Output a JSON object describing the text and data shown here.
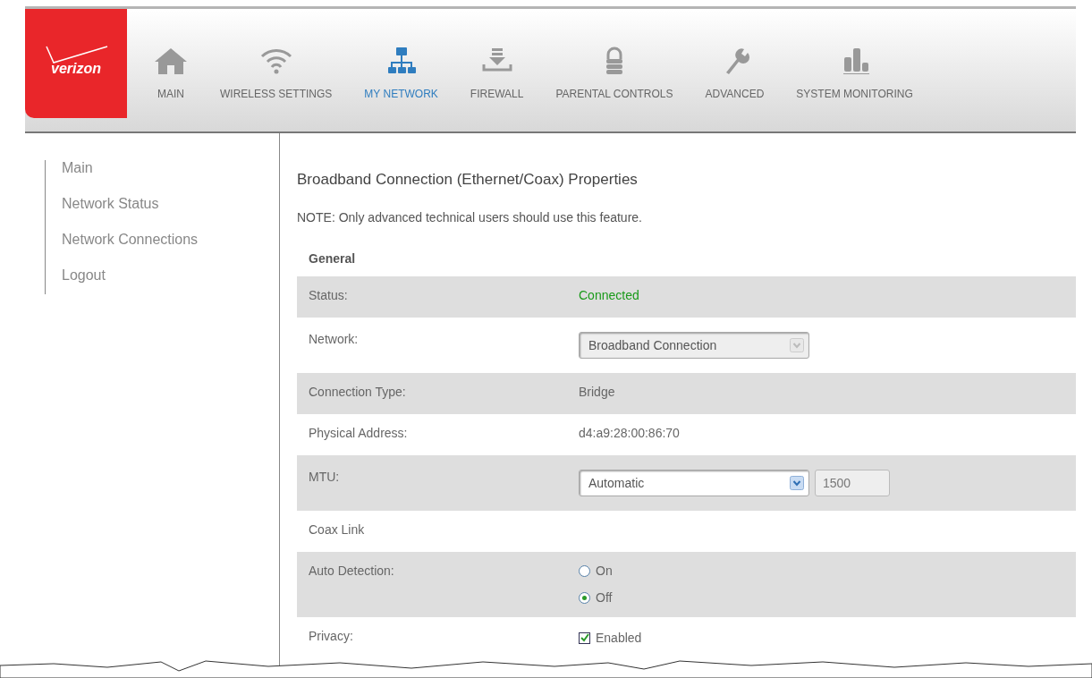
{
  "logo": {
    "text": "verizon"
  },
  "nav": [
    {
      "label": "MAIN",
      "kind": "home",
      "selected": false
    },
    {
      "label": "WIRELESS SETTINGS",
      "kind": "wifi",
      "selected": false
    },
    {
      "label": "MY NETWORK",
      "kind": "network",
      "selected": true
    },
    {
      "label": "FIREWALL",
      "kind": "firewall",
      "selected": false
    },
    {
      "label": "PARENTAL CONTROLS",
      "kind": "lock",
      "selected": false
    },
    {
      "label": "ADVANCED",
      "kind": "wrench",
      "selected": false
    },
    {
      "label": "SYSTEM MONITORING",
      "kind": "chart",
      "selected": false
    }
  ],
  "sidebar": {
    "items": [
      {
        "label": "Main"
      },
      {
        "label": "Network Status"
      },
      {
        "label": "Network Connections"
      },
      {
        "label": "Logout"
      }
    ]
  },
  "title": "Broadband Connection (Ethernet/Coax) Properties",
  "note": "NOTE: Only advanced technical users should use this feature.",
  "section": "General",
  "rows": [
    {
      "kind": "status",
      "label": "Status:",
      "value": "Connected"
    },
    {
      "kind": "select",
      "label": "Network:",
      "value": "Broadband Connection",
      "disabled": true
    },
    {
      "kind": "text",
      "label": "Connection Type:",
      "value": "Bridge"
    },
    {
      "kind": "text",
      "label": "Physical Address:",
      "value": "d4:a9:28:00:86:70"
    },
    {
      "kind": "mtu",
      "label": "MTU:",
      "value": "Automatic",
      "input": "1500",
      "disabled": false
    },
    {
      "kind": "heading",
      "label": "Coax Link"
    },
    {
      "kind": "radio",
      "label": "Auto Detection:",
      "options": [
        {
          "label": "On",
          "selected": false
        },
        {
          "label": "Off",
          "selected": true
        }
      ]
    },
    {
      "kind": "checkbox",
      "label": "Privacy:",
      "option": "Enabled",
      "checked": true
    }
  ]
}
